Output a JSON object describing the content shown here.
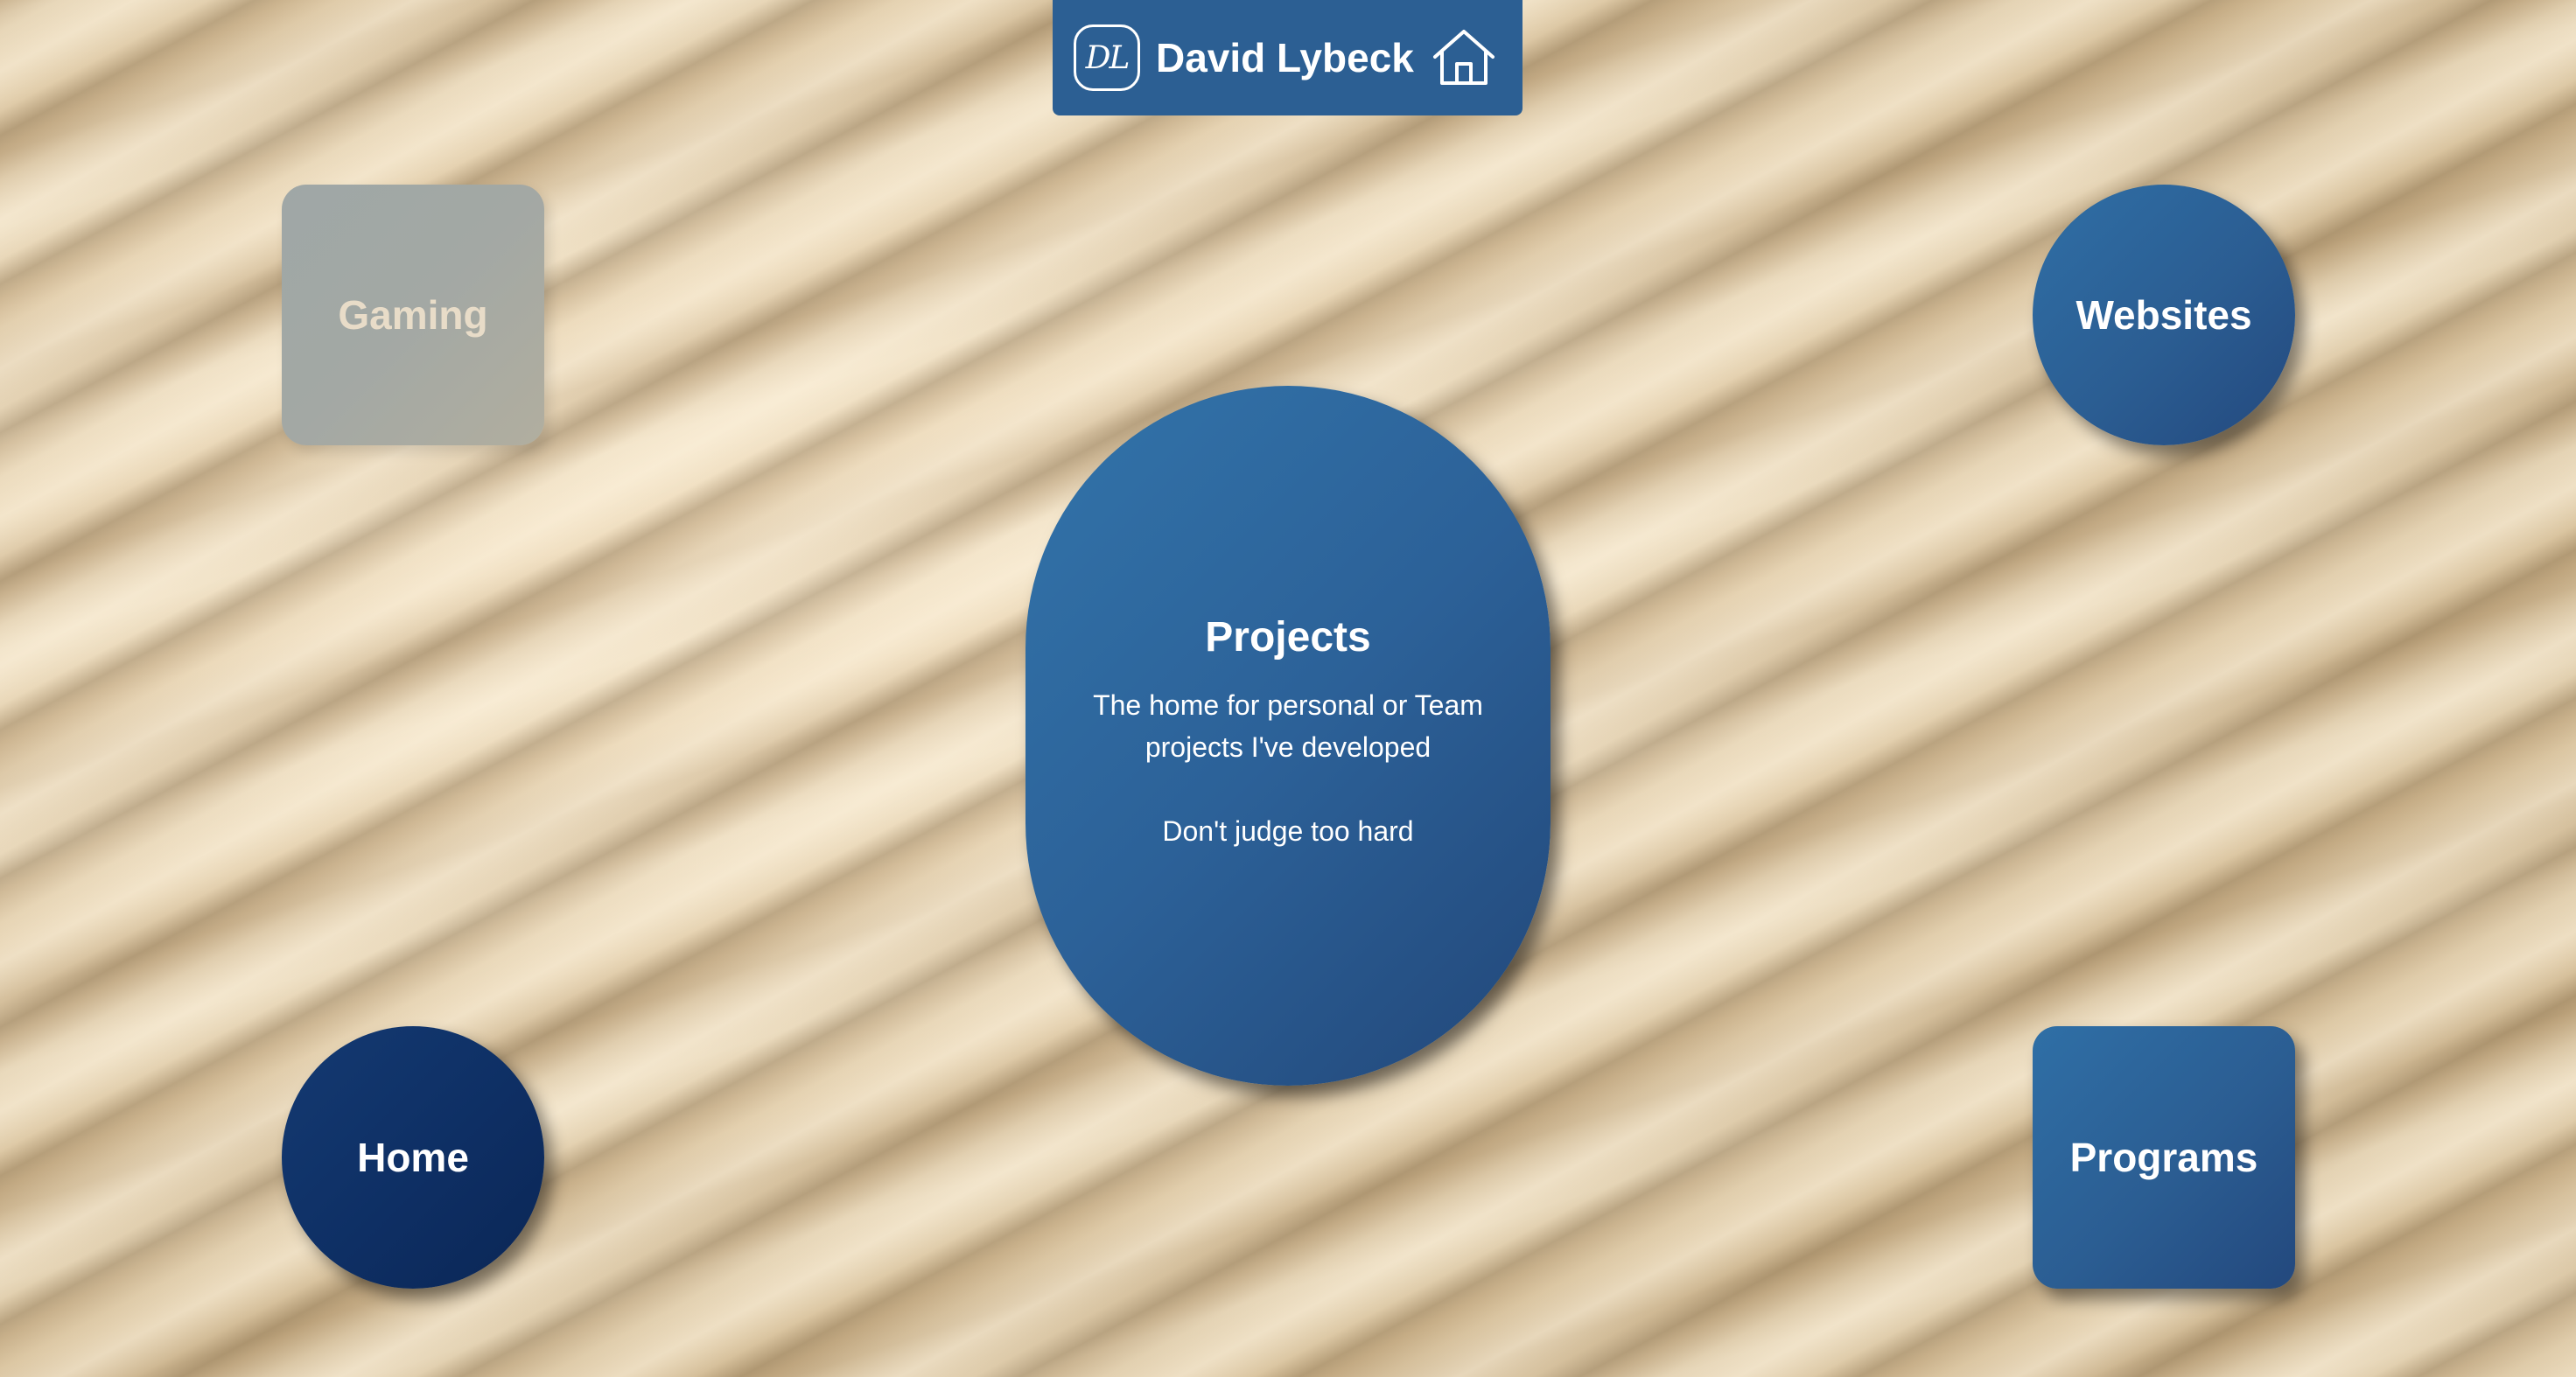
{
  "header": {
    "logo_text": "DL",
    "title": "David Lybeck",
    "home_icon": "home-icon"
  },
  "tiles": {
    "gaming": "Gaming",
    "websites": "Websites",
    "home": "Home",
    "programs": "Programs"
  },
  "projects": {
    "title": "Projects",
    "description": "The home for personal or Team projects I've developed",
    "note": "Don't judge too hard"
  },
  "colors": {
    "header_bg": "#2c5f93",
    "tile_blue": "#2b5d92",
    "home_navy": "#0e2f64",
    "gaming_gray": "#a3a8a4",
    "sand": "#dcc6a0"
  }
}
